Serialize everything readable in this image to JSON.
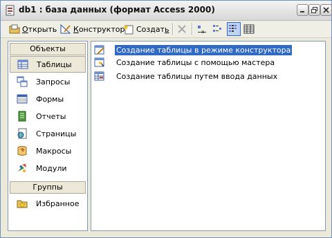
{
  "window": {
    "title": "db1 : база данных (формат Access 2000)"
  },
  "toolbar": {
    "open_label": "Открыть",
    "open_mnemonic": "О",
    "open_rest": "ткрыть",
    "design_mnemonic": "К",
    "design_rest": "онструктор",
    "create_mnemonic": "",
    "create_pre": "Создат",
    "create_mn": "ь",
    "icons": [
      "open-icon",
      "design-icon",
      "create-icon",
      "delete-icon",
      "large-icons-icon",
      "small-icons-icon",
      "list-view-icon",
      "details-view-icon"
    ]
  },
  "sidebar": {
    "objects_header": "Объекты",
    "groups_header": "Группы",
    "items": [
      {
        "label": "Таблицы",
        "icon": "tables-icon",
        "selected": true
      },
      {
        "label": "Запросы",
        "icon": "queries-icon"
      },
      {
        "label": "Формы",
        "icon": "forms-icon"
      },
      {
        "label": "Отчеты",
        "icon": "reports-icon"
      },
      {
        "label": "Страницы",
        "icon": "pages-icon"
      },
      {
        "label": "Макросы",
        "icon": "macros-icon"
      },
      {
        "label": "Модули",
        "icon": "modules-icon"
      }
    ],
    "groups": [
      {
        "label": "Избранное",
        "icon": "favorites-icon"
      }
    ]
  },
  "content": {
    "items": [
      {
        "label": "Создание таблицы в режиме конструктора",
        "icon": "design-wizard-icon",
        "selected": true
      },
      {
        "label": "Создание таблицы с помощью мастера",
        "icon": "wizard-icon"
      },
      {
        "label": "Создание таблицы путем ввода данных",
        "icon": "data-entry-icon"
      }
    ]
  },
  "colors": {
    "selection": "#316ac5",
    "panel_bg": "#ece9d8",
    "border": "#7f9db9"
  }
}
